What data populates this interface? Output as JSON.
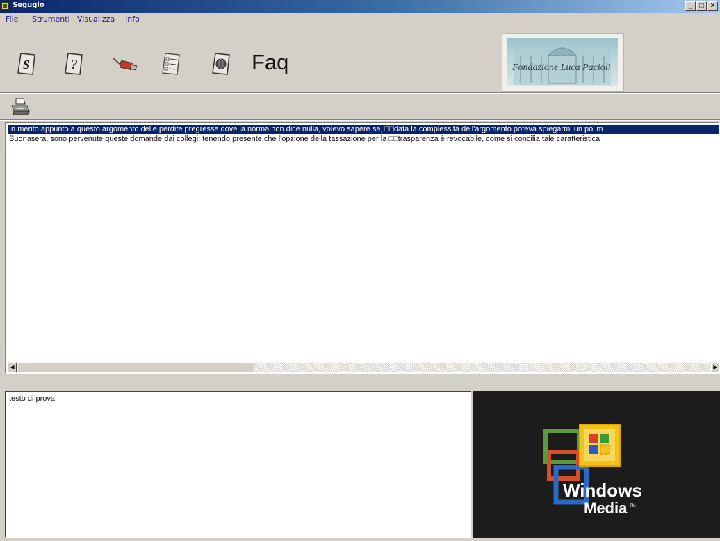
{
  "window": {
    "title": "Segugio",
    "minimize": "_",
    "maximize": "□",
    "close": "×"
  },
  "menu": {
    "items": [
      "File",
      "Strumenti",
      "Visualizza",
      "Info"
    ]
  },
  "toolbar": {
    "buttons": [
      {
        "icon": "document-s-icon"
      },
      {
        "icon": "help-icon"
      },
      {
        "icon": "connect-icon"
      },
      {
        "icon": "list-icon"
      },
      {
        "icon": "globe-icon"
      }
    ],
    "faq_label": "Faq",
    "logo_text": "Fondazione Luca Pacioli"
  },
  "list": {
    "rows": [
      "In merito appunto a questo argomento delle perdite pregresse dove la norma non dice nulla, volevo sapere se, □□data la complessità dell'argomento poteva spiegarmi un po' m",
      "Buonasera, sono pervenute queste domande dai collegi: tenendo presente che l'opzione della tassazione per la □□trasparenza è revocabile, come si concilia tale caratteristica"
    ],
    "selected_index": 0
  },
  "detail": {
    "text": "testo di prova"
  },
  "media": {
    "brand_line1": "Windows",
    "brand_line2": "Media",
    "trademark": "TM"
  },
  "colors": {
    "selection": "#0a246a",
    "title_gradient_start": "#0a246a",
    "media_bg": "#1c1c1c"
  }
}
